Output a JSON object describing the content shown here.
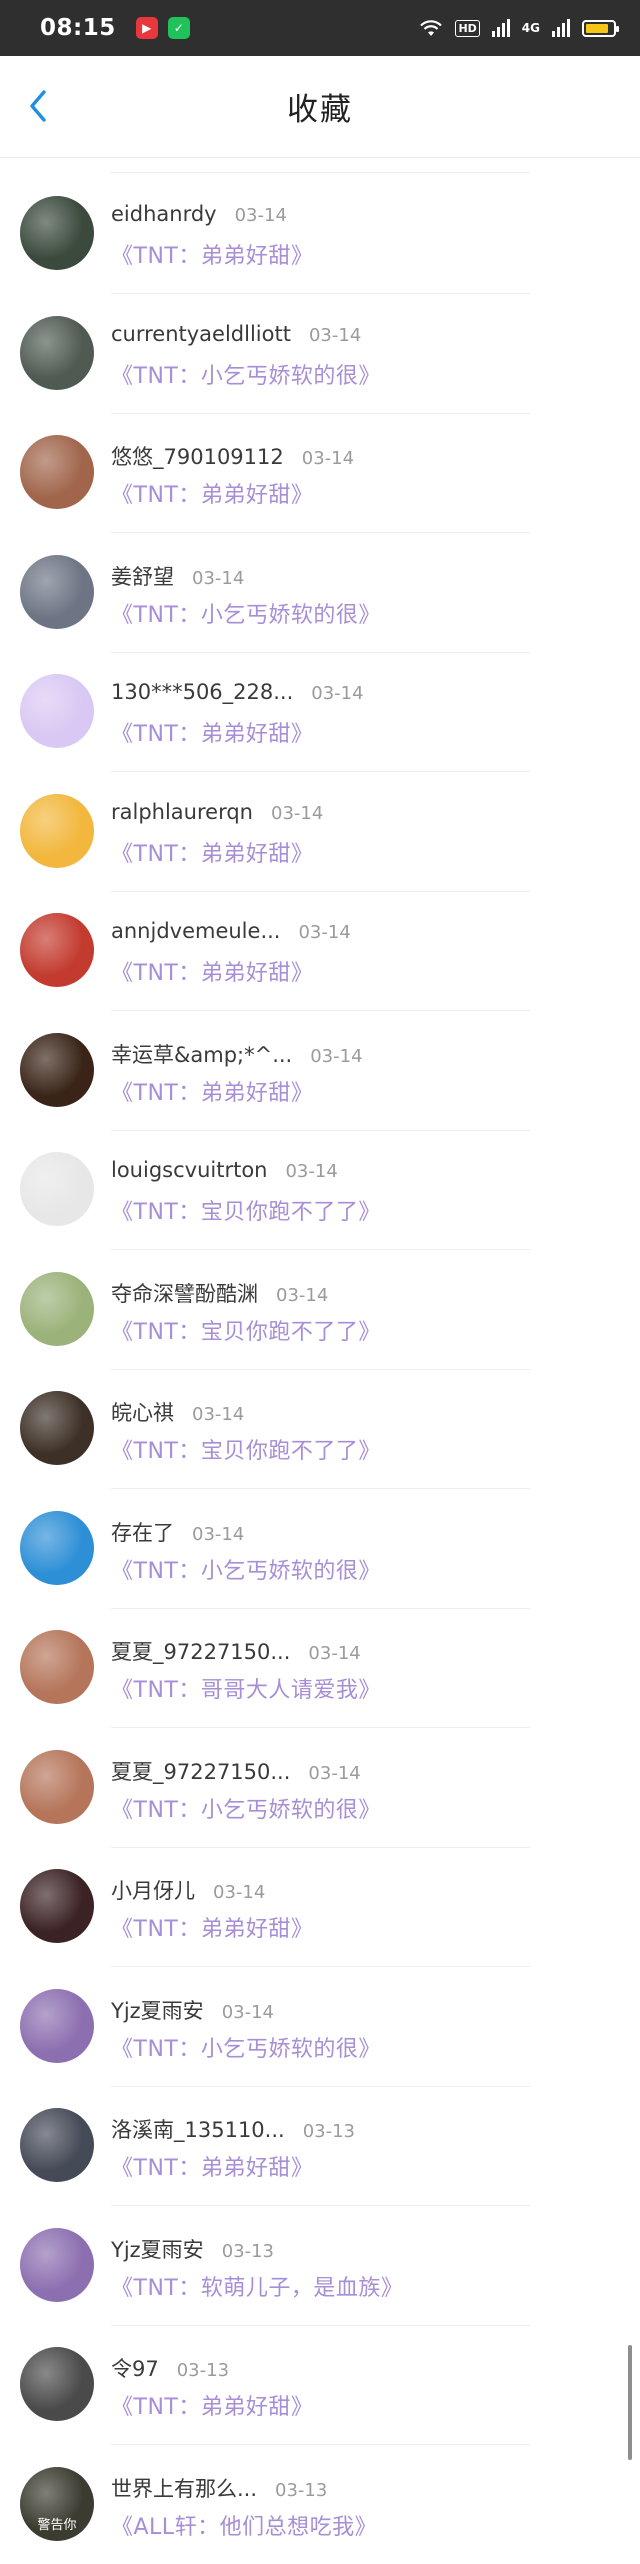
{
  "status_bar": {
    "time": "08:15",
    "hd_label": "HD",
    "network_label": "4G"
  },
  "header": {
    "title": "收藏"
  },
  "items": [
    {
      "name": "eidhanrdy",
      "date": "03-14",
      "snippet": "《TNT：弟弟好甜》",
      "avatar_color": "#3b4a3d"
    },
    {
      "name": "currentyaeldlliott",
      "date": "03-14",
      "snippet": "《TNT：小乞丐娇软的很》",
      "avatar_color": "#4f5a52"
    },
    {
      "name": "悠悠_790109112",
      "date": "03-14",
      "snippet": "《TNT：弟弟好甜》",
      "avatar_color": "#a0654b"
    },
    {
      "name": "姜舒望",
      "date": "03-14",
      "snippet": "《TNT：小乞丐娇软的很》",
      "avatar_color": "#6d7584"
    },
    {
      "name": "130***506_228...",
      "date": "03-14",
      "snippet": "《TNT：弟弟好甜》",
      "avatar_color": "#d9c8f3"
    },
    {
      "name": "ralphlaurerqn",
      "date": "03-14",
      "snippet": "《TNT：弟弟好甜》",
      "avatar_color": "#f2b73c"
    },
    {
      "name": "annjdvemeule...",
      "date": "03-14",
      "snippet": "《TNT：弟弟好甜》",
      "avatar_color": "#c33a2e"
    },
    {
      "name": "幸运草&amp;*^...",
      "date": "03-14",
      "snippet": "《TNT：弟弟好甜》",
      "avatar_color": "#3a2418"
    },
    {
      "name": "louigscvuitrton",
      "date": "03-14",
      "snippet": "《TNT：宝贝你跑不了了》",
      "avatar_color": "#e7e7e7"
    },
    {
      "name": "夺命深譬酚酷渊",
      "date": "03-14",
      "snippet": "《TNT：宝贝你跑不了了》",
      "avatar_color": "#9bb27a"
    },
    {
      "name": "皖心祺",
      "date": "03-14",
      "snippet": "《TNT：宝贝你跑不了了》",
      "avatar_color": "#3d3027"
    },
    {
      "name": "存在了",
      "date": "03-14",
      "snippet": "《TNT：小乞丐娇软的很》",
      "avatar_color": "#2d8fd6"
    },
    {
      "name": "夏夏_97227150...",
      "date": "03-14",
      "snippet": "《TNT：哥哥大人请爱我》",
      "avatar_color": "#b5755a"
    },
    {
      "name": "夏夏_97227150...",
      "date": "03-14",
      "snippet": "《TNT：小乞丐娇软的很》",
      "avatar_color": "#b5755a"
    },
    {
      "name": "小月伢儿",
      "date": "03-14",
      "snippet": "《TNT：弟弟好甜》",
      "avatar_color": "#3b2224"
    },
    {
      "name": "Yjz夏雨安",
      "date": "03-14",
      "snippet": "《TNT：小乞丐娇软的很》",
      "avatar_color": "#8c6fb0"
    },
    {
      "name": "洛溪南_135110...",
      "date": "03-13",
      "snippet": "《TNT：弟弟好甜》",
      "avatar_color": "#454a57"
    },
    {
      "name": "Yjz夏雨安",
      "date": "03-13",
      "snippet": "《TNT：软萌儿子，是血族》",
      "avatar_color": "#8c6fb0"
    },
    {
      "name": "令97",
      "date": "03-13",
      "snippet": "《TNT：弟弟好甜》",
      "avatar_color": "#4a4a4a"
    },
    {
      "name": "世界上有那么...",
      "date": "03-13",
      "snippet": "《ALL轩：他们总想吃我》",
      "avatar_color": "#3b3b30",
      "avatar_caption": "警告你"
    }
  ]
}
